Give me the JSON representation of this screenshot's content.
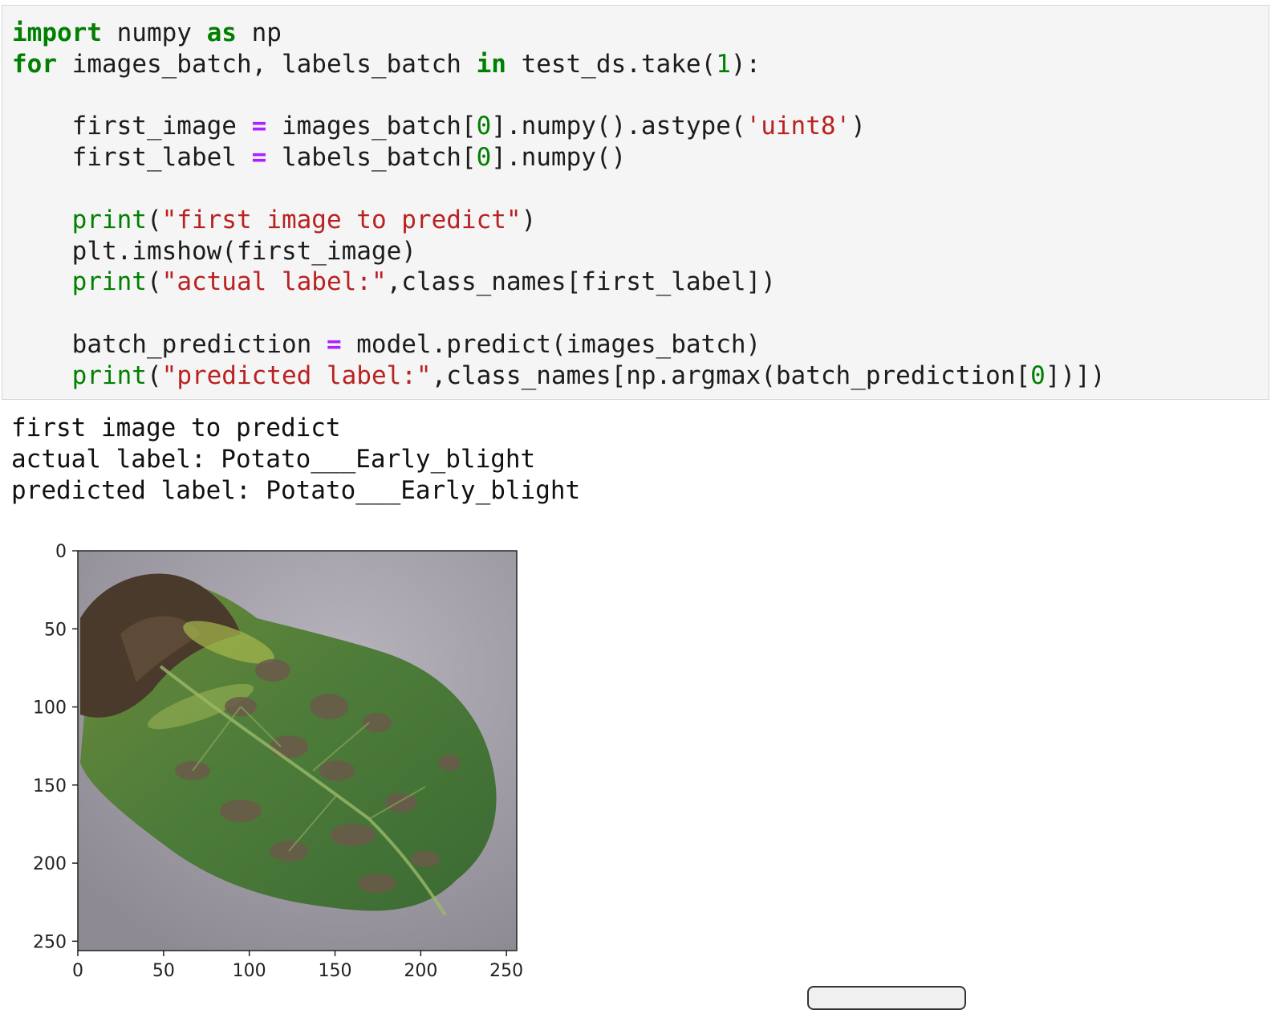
{
  "code_cell": {
    "lines": [
      [
        [
          "kw",
          "import"
        ],
        [
          "t",
          " numpy "
        ],
        [
          "kw",
          "as"
        ],
        [
          "t",
          " np"
        ]
      ],
      [
        [
          "kw",
          "for"
        ],
        [
          "t",
          " images_batch, labels_batch "
        ],
        [
          "kw",
          "in"
        ],
        [
          "t",
          " test_ds.take("
        ],
        [
          "num",
          "1"
        ],
        [
          "t",
          "):"
        ]
      ],
      [],
      [
        [
          "t",
          "    first_image "
        ],
        [
          "op",
          "="
        ],
        [
          "t",
          " images_batch["
        ],
        [
          "num",
          "0"
        ],
        [
          "t",
          "].numpy().astype("
        ],
        [
          "str",
          "'uint8'"
        ],
        [
          "t",
          ")"
        ]
      ],
      [
        [
          "t",
          "    first_label "
        ],
        [
          "op",
          "="
        ],
        [
          "t",
          " labels_batch["
        ],
        [
          "num",
          "0"
        ],
        [
          "t",
          "].numpy()"
        ]
      ],
      [],
      [
        [
          "t",
          "    "
        ],
        [
          "bi",
          "print"
        ],
        [
          "t",
          "("
        ],
        [
          "str",
          "\"first image to predict\""
        ],
        [
          "t",
          ")"
        ]
      ],
      [
        [
          "t",
          "    plt.imshow(first_image)"
        ]
      ],
      [
        [
          "t",
          "    "
        ],
        [
          "bi",
          "print"
        ],
        [
          "t",
          "("
        ],
        [
          "str",
          "\"actual label:\""
        ],
        [
          "t",
          ",class_names[first_label])"
        ]
      ],
      [],
      [
        [
          "t",
          "    batch_prediction "
        ],
        [
          "op",
          "="
        ],
        [
          "t",
          " model.predict(images_batch)"
        ]
      ],
      [
        [
          "t",
          "    "
        ],
        [
          "bi",
          "print"
        ],
        [
          "t",
          "("
        ],
        [
          "str",
          "\"predicted label:\""
        ],
        [
          "t",
          ",class_names[np.argmax(batch_prediction["
        ],
        [
          "num",
          "0"
        ],
        [
          "t",
          "])])"
        ]
      ]
    ]
  },
  "output": {
    "lines": [
      "first image to predict",
      "actual label: Potato___Early_blight",
      "predicted label: Potato___Early_blight"
    ]
  },
  "plot": {
    "image_description": "potato leaf image",
    "y_ticks": [
      "0",
      "50",
      "100",
      "150",
      "200",
      "250"
    ],
    "x_ticks": [
      "0",
      "50",
      "100",
      "150",
      "200",
      "250"
    ],
    "extent": 256
  },
  "colors": {
    "keyword": "#008000",
    "string": "#ba2121",
    "operator": "#aa22ff",
    "cell_background": "#f5f5f5"
  }
}
